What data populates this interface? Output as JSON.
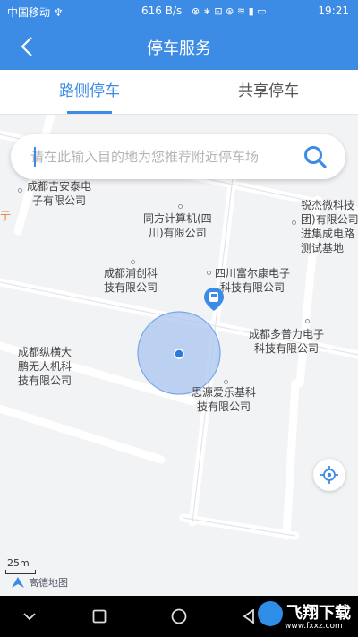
{
  "status_bar": {
    "carrier": "中国移动 ♆",
    "network_speed": "616 B/s",
    "time": "19:21"
  },
  "app_bar": {
    "title": "停车服务"
  },
  "tabs": [
    {
      "label": "路侧停车",
      "active": true
    },
    {
      "label": "共享停车",
      "active": false
    }
  ],
  "search": {
    "placeholder": "请在此输入目的地为您推荐附近停车场",
    "value": ""
  },
  "map": {
    "pois": [
      {
        "name": "成都吉安泰电子有限公司",
        "lines": [
          "成都吉安泰电",
          "子有限公司"
        ]
      },
      {
        "name": "锐杰微科技",
        "lines": [
          "锐杰微科技",
          "团)有限公司",
          "进集成电路",
          "测试基地"
        ]
      },
      {
        "name": "同方计算机",
        "lines": [
          "同方计算机(四",
          "川)有限公司"
        ]
      },
      {
        "name": "成都浦创科技",
        "lines": [
          "成都浦创科",
          "技有限公司"
        ]
      },
      {
        "name": "四川富尔康电子",
        "lines": [
          "四川富尔康电子",
          "科技有限公司"
        ]
      },
      {
        "name": "成都多普力电子",
        "lines": [
          "成都多普力电子",
          "科技有限公司"
        ]
      },
      {
        "name": "成都纵横大鹏",
        "lines": [
          "成都纵横大",
          "鹏无人机科",
          "技有限公司"
        ]
      },
      {
        "name": "思源爱乐基科技",
        "lines": [
          "思源爱乐基科",
          "技有限公司"
        ]
      }
    ],
    "edge_label": "亍",
    "scale_label": "25m",
    "provider": "高德地图"
  },
  "watermark": {
    "text": "飞翔下载",
    "url": "www.fxxz.com"
  },
  "colors": {
    "primary": "#3c8ce6",
    "location_fill": "#a9c6ef",
    "location_dot": "#2a7ae2"
  }
}
